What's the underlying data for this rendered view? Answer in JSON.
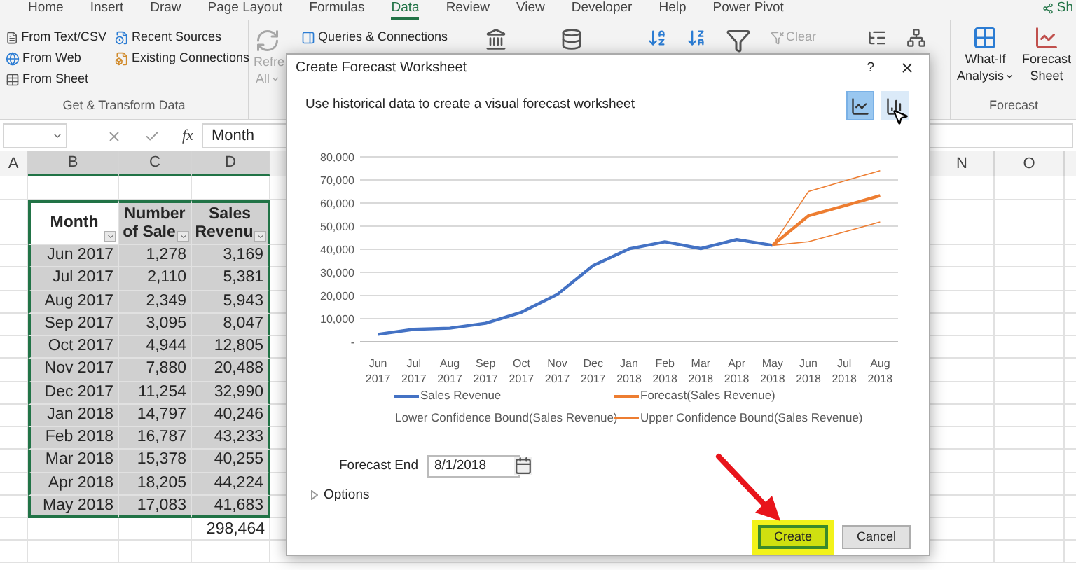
{
  "ribbon": {
    "tabs": [
      {
        "label": "Home",
        "selected": false
      },
      {
        "label": "Insert",
        "selected": false
      },
      {
        "label": "Draw",
        "selected": false
      },
      {
        "label": "Page Layout",
        "selected": false
      },
      {
        "label": "Formulas",
        "selected": false
      },
      {
        "label": "Data",
        "selected": true
      },
      {
        "label": "Review",
        "selected": false
      },
      {
        "label": "View",
        "selected": false
      },
      {
        "label": "Developer",
        "selected": false
      },
      {
        "label": "Help",
        "selected": false
      },
      {
        "label": "Power Pivot",
        "selected": false
      }
    ],
    "share": "Sh",
    "get_transform": {
      "column_1": [
        "From Text/CSV",
        "From Web",
        "From Sheet"
      ],
      "column_2": [
        "Recent Sources",
        "Existing Connections"
      ],
      "label": "Get & Transform Data"
    },
    "refresh": [
      "Refre",
      "All"
    ],
    "queries": "Queries & Connections",
    "clear": "Clear",
    "forecast_group": {
      "buttons": [
        {
          "lines": [
            "What-If",
            "Analysis"
          ],
          "dropdown": true
        },
        {
          "lines": [
            "Forecast",
            "Sheet"
          ],
          "dropdown": false
        }
      ],
      "label": "Forecast"
    }
  },
  "formula_bar": {
    "fx": "fx",
    "value": "Month"
  },
  "columns_left": [
    "A",
    "B",
    "C",
    "D"
  ],
  "columns_right": [
    "N",
    "O"
  ],
  "table": {
    "headers": [
      [
        "Month"
      ],
      [
        "Number",
        "of Sale"
      ],
      [
        "Sales",
        "Revenu"
      ]
    ],
    "rows": [
      [
        "Jun 2017",
        "1,278",
        "3,169"
      ],
      [
        "Jul 2017",
        "2,110",
        "5,381"
      ],
      [
        "Aug 2017",
        "2,349",
        "5,943"
      ],
      [
        "Sep 2017",
        "3,095",
        "8,047"
      ],
      [
        "Oct 2017",
        "4,944",
        "12,805"
      ],
      [
        "Nov 2017",
        "7,880",
        "20,488"
      ],
      [
        "Dec 2017",
        "11,254",
        "32,990"
      ],
      [
        "Jan 2018",
        "14,797",
        "40,246"
      ],
      [
        "Feb 2018",
        "16,787",
        "43,233"
      ],
      [
        "Mar 2018",
        "15,378",
        "40,255"
      ],
      [
        "Apr 2018",
        "18,205",
        "44,224"
      ],
      [
        "May 2018",
        "17,083",
        "41,683"
      ]
    ],
    "total": "298,464"
  },
  "dialog": {
    "title": "Create Forecast Worksheet",
    "help": "?",
    "subtitle": "Use historical data to create a visual forecast worksheet",
    "chart_types": [
      {
        "kind": "line",
        "selected": true
      },
      {
        "kind": "column",
        "selected": false
      }
    ],
    "chart_data": {
      "type": "line",
      "grid": true,
      "categories": [
        "Jun 2017",
        "Jul 2017",
        "Aug 2017",
        "Sep 2017",
        "Oct 2017",
        "Nov 2017",
        "Dec 2017",
        "Jan 2018",
        "Feb 2018",
        "Mar 2018",
        "Apr 2018",
        "May 2018",
        "Jun 2018",
        "Jul 2018",
        "Aug 2018"
      ],
      "ylim": [
        0,
        80000
      ],
      "yticks": [
        {
          "value": 0,
          "label": "-"
        },
        {
          "value": 10000,
          "label": "10,000"
        },
        {
          "value": 20000,
          "label": "20,000"
        },
        {
          "value": 30000,
          "label": "30,000"
        },
        {
          "value": 40000,
          "label": "40,000"
        },
        {
          "value": 50000,
          "label": "50,000"
        },
        {
          "value": 60000,
          "label": "60,000"
        },
        {
          "value": 70000,
          "label": "70,000"
        },
        {
          "value": 80000,
          "label": "80,000"
        }
      ],
      "series": [
        {
          "name": "Sales Revenue",
          "color": "#4472c4",
          "values": [
            3200,
            5400,
            5900,
            8000,
            12800,
            20500,
            33000,
            40200,
            43200,
            40300,
            44200,
            41700,
            null,
            null,
            null
          ]
        },
        {
          "name": "Forecast(Sales Revenue)",
          "color": "#ed7d31",
          "values": [
            null,
            null,
            null,
            null,
            null,
            null,
            null,
            null,
            null,
            null,
            null,
            41700,
            54500,
            58800,
            63200
          ]
        },
        {
          "name": "Lower Confidence Bound(Sales Revenue)",
          "color": "#ed7d31",
          "values": [
            null,
            null,
            null,
            null,
            null,
            null,
            null,
            null,
            null,
            null,
            null,
            41700,
            43300,
            47500,
            51800
          ]
        },
        {
          "name": "Upper Confidence Bound(Sales Revenue)",
          "color": "#ed7d31",
          "values": [
            null,
            null,
            null,
            null,
            null,
            null,
            null,
            null,
            null,
            null,
            null,
            41700,
            65000,
            69600,
            74000
          ]
        }
      ]
    },
    "forecast_end": {
      "label": "Forecast End",
      "value": "8/1/2018"
    },
    "options": {
      "label": "Options",
      "expanded": false
    },
    "buttons": [
      {
        "label": "Create",
        "highlighted": true
      },
      {
        "label": "Cancel",
        "highlighted": false
      }
    ]
  }
}
